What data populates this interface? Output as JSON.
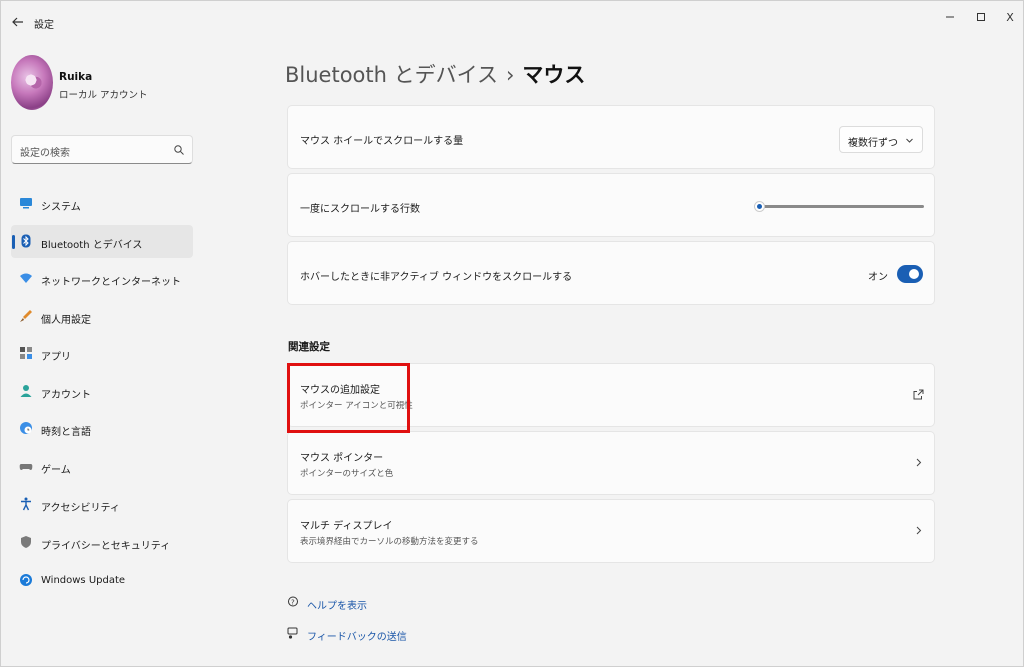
{
  "window": {
    "title": "設定",
    "controls": {
      "minimize": "—",
      "maximize": "☐",
      "close": "X"
    }
  },
  "profile": {
    "name": "Ruika",
    "account_type": "ローカル アカウント"
  },
  "search": {
    "placeholder": "設定の検索"
  },
  "sidebar": {
    "items": [
      {
        "label": "システム",
        "icon": "monitor-icon",
        "active": false
      },
      {
        "label": "Bluetooth とデバイス",
        "icon": "bluetooth-icon",
        "active": true
      },
      {
        "label": "ネットワークとインターネット",
        "icon": "network-icon",
        "active": false
      },
      {
        "label": "個人用設定",
        "icon": "brush-icon",
        "active": false
      },
      {
        "label": "アプリ",
        "icon": "apps-icon",
        "active": false
      },
      {
        "label": "アカウント",
        "icon": "account-icon",
        "active": false
      },
      {
        "label": "時刻と言語",
        "icon": "globe-clock-icon",
        "active": false
      },
      {
        "label": "ゲーム",
        "icon": "gamepad-icon",
        "active": false
      },
      {
        "label": "アクセシビリティ",
        "icon": "accessibility-icon",
        "active": false
      },
      {
        "label": "プライバシーとセキュリティ",
        "icon": "shield-icon",
        "active": false
      },
      {
        "label": "Windows Update",
        "icon": "update-icon",
        "active": false
      }
    ]
  },
  "breadcrumb": {
    "parent": "Bluetooth とデバイス",
    "separator": "›",
    "current": "マウス"
  },
  "settings": {
    "scroll_amount": {
      "label": "マウス ホイールでスクロールする量",
      "value": "複数行ずつ"
    },
    "lines_per_scroll": {
      "label": "一度にスクロールする行数",
      "slider_fraction": 0.03
    },
    "inactive_scroll": {
      "label": "ホバーしたときに非アクティブ ウィンドウをスクロールする",
      "state_label": "オン",
      "on": true
    }
  },
  "related": {
    "title": "関連設定",
    "items": [
      {
        "title": "マウスの追加設定",
        "subtitle": "ポインター アイコンと可視性",
        "icon": "external-link-icon"
      },
      {
        "title": "マウス ポインター",
        "subtitle": "ポインターのサイズと色",
        "icon": "chevron-right-icon"
      },
      {
        "title": "マルチ ディスプレイ",
        "subtitle": "表示境界経由でカーソルの移動方法を変更する",
        "icon": "chevron-right-icon"
      }
    ]
  },
  "footer": {
    "help": "ヘルプを表示",
    "feedback": "フィードバックの送信"
  },
  "colors": {
    "accent": "#1a5fb4",
    "highlight": "#e01010",
    "background": "#f3f3f3",
    "card": "#fbfbfb"
  }
}
